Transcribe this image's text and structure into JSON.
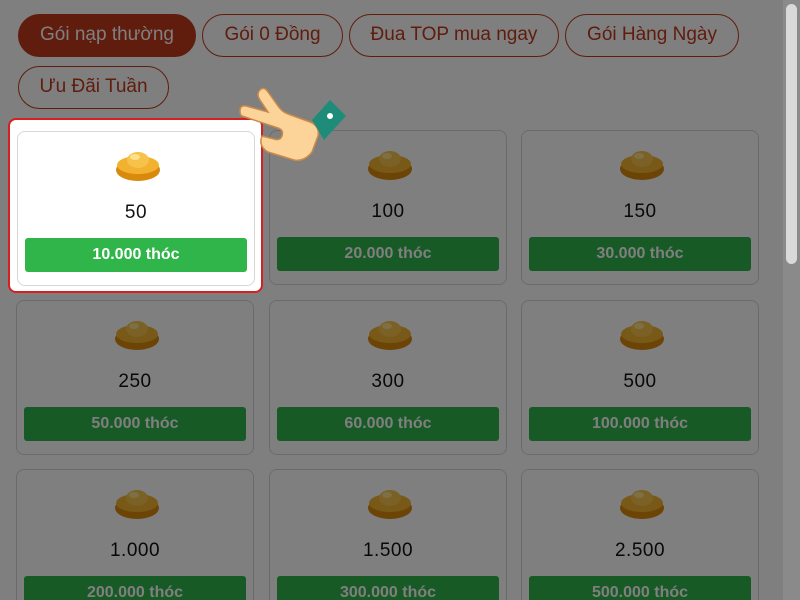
{
  "tabs": [
    {
      "label": "Gói nạp thường",
      "active": true
    },
    {
      "label": "Gói 0 Đồng",
      "active": false
    },
    {
      "label": "Đua TOP mua ngay",
      "active": false
    },
    {
      "label": "Gói Hàng Ngày",
      "active": false
    },
    {
      "label": "Ưu Đãi Tuần",
      "active": false
    }
  ],
  "packages": [
    {
      "amount": "50",
      "price": "10.000 thóc",
      "icon": "gold-ingot-icon",
      "highlighted": true
    },
    {
      "amount": "100",
      "price": "20.000 thóc",
      "icon": "gold-ingot-icon"
    },
    {
      "amount": "150",
      "price": "30.000 thóc",
      "icon": "gold-ingot-icon"
    },
    {
      "amount": "250",
      "price": "50.000 thóc",
      "icon": "gold-ingot-icon"
    },
    {
      "amount": "300",
      "price": "60.000 thóc",
      "icon": "gold-ingot-icon"
    },
    {
      "amount": "500",
      "price": "100.000 thóc",
      "icon": "gold-ingot-icon"
    },
    {
      "amount": "1.000",
      "price": "200.000 thóc",
      "icon": "gold-ingot-icon"
    },
    {
      "amount": "1.500",
      "price": "300.000 thóc",
      "icon": "gold-ingot-icon"
    },
    {
      "amount": "2.500",
      "price": "500.000 thóc",
      "icon": "gold-ingot-icon"
    }
  ],
  "pointer": {
    "icon": "pointing-hand-icon"
  },
  "colors": {
    "accent": "#c0391b",
    "price_button": "#2fb54a",
    "highlight_border": "#d42020",
    "ingot": "#e8a217"
  }
}
